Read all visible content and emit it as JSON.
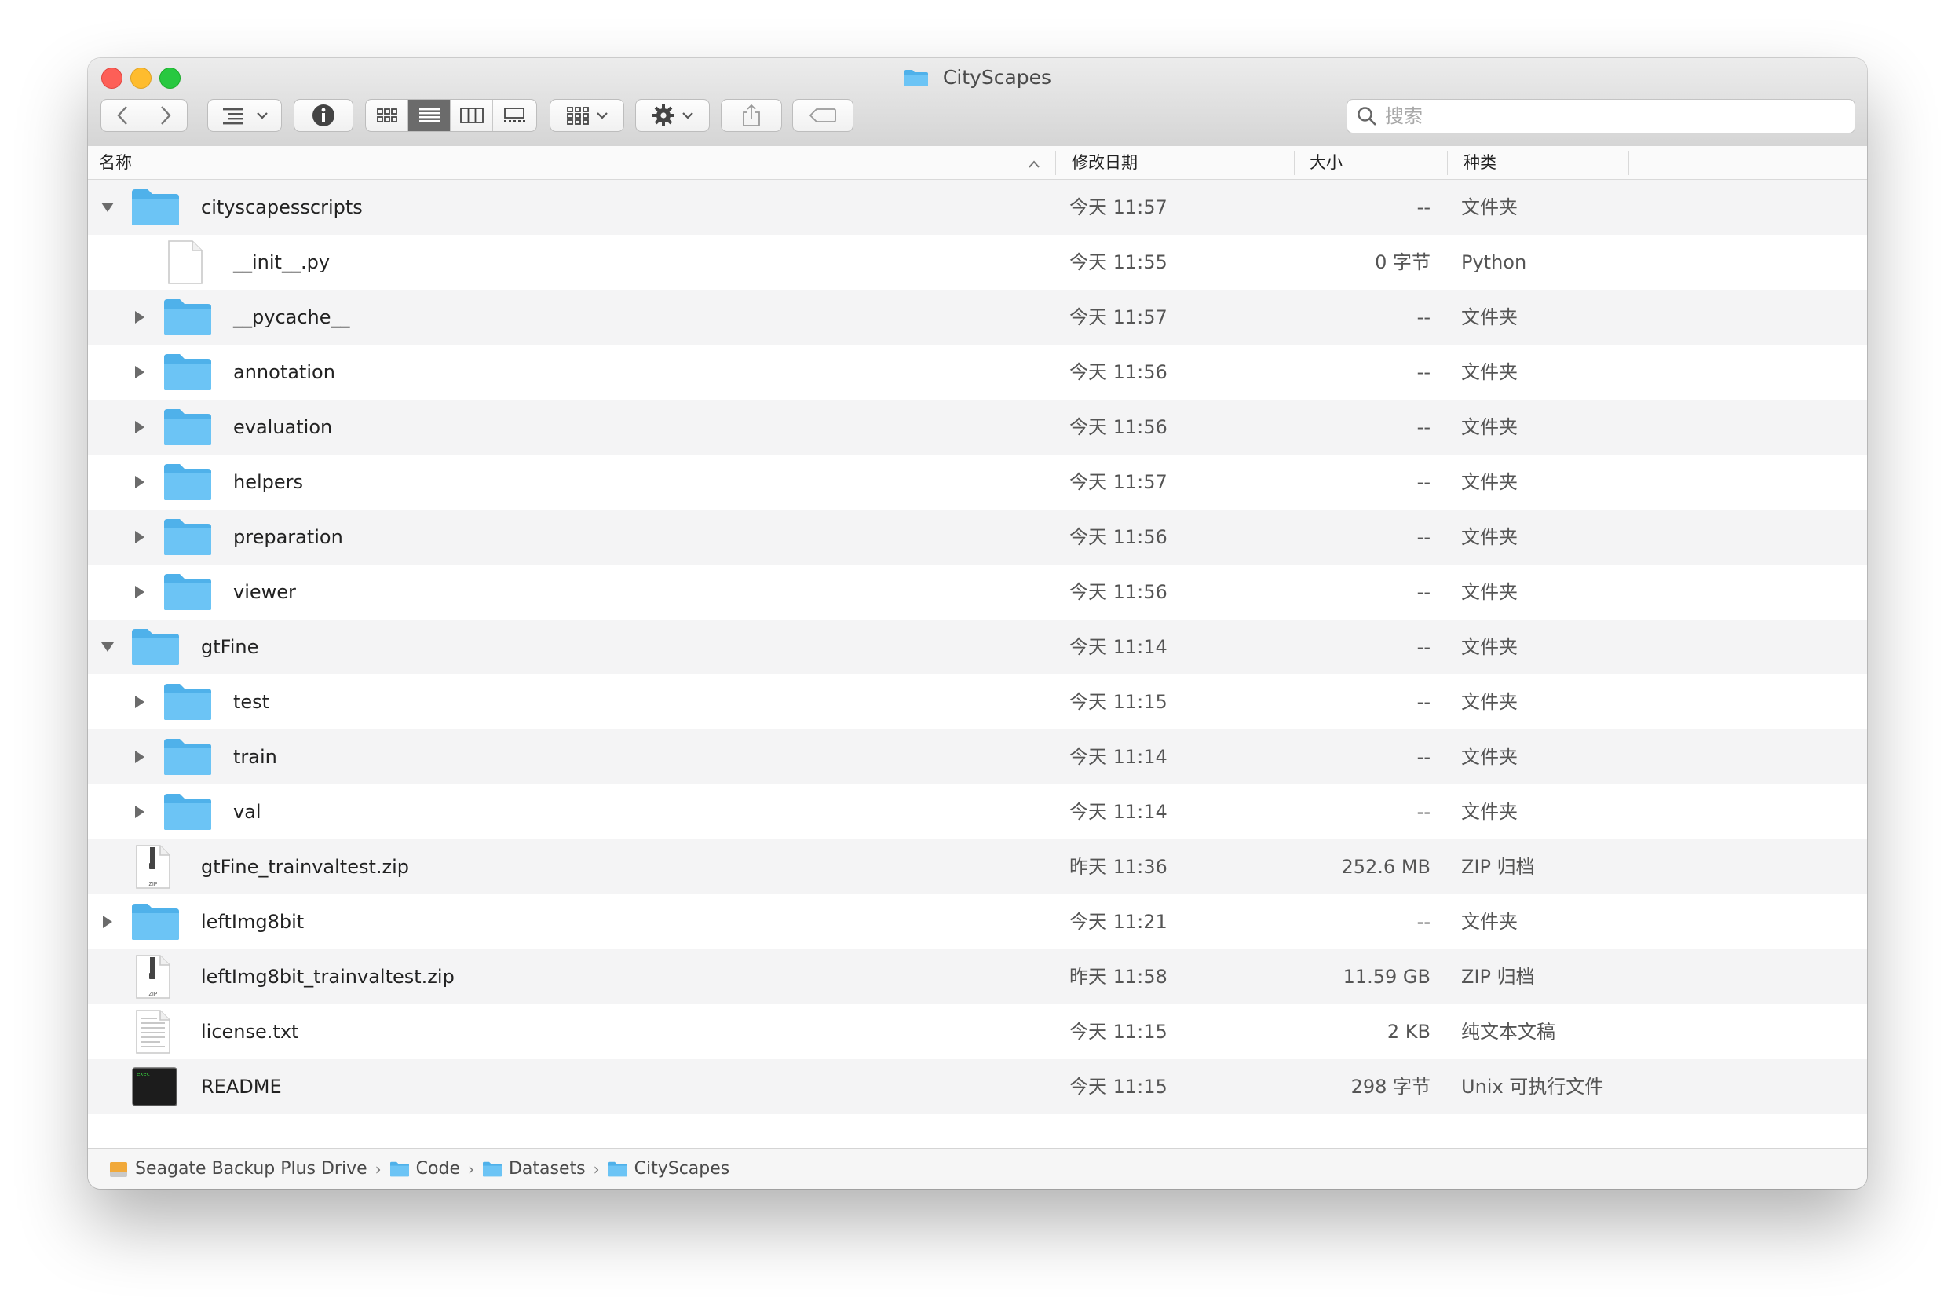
{
  "window": {
    "title": "CityScapes"
  },
  "toolbar": {
    "back_icon": "chevron-left-icon",
    "forward_icon": "chevron-right-icon",
    "search_placeholder": "搜索"
  },
  "columns": {
    "name": "名称",
    "date": "修改日期",
    "size": "大小",
    "kind": "种类"
  },
  "rows": [
    {
      "name": "cityscapesscripts",
      "date": "今天 11:57",
      "size": "--",
      "kind": "文件夹",
      "icon": "folder-icon",
      "disclosure": "expanded"
    },
    {
      "name": "__init__.py",
      "date": "今天 11:55",
      "size": "0 字节",
      "kind": "Python",
      "icon": "document-icon",
      "disclosure": "none"
    },
    {
      "name": "__pycache__",
      "date": "今天 11:57",
      "size": "--",
      "kind": "文件夹",
      "icon": "folder-icon",
      "disclosure": "collapsed"
    },
    {
      "name": "annotation",
      "date": "今天 11:56",
      "size": "--",
      "kind": "文件夹",
      "icon": "folder-icon",
      "disclosure": "collapsed"
    },
    {
      "name": "evaluation",
      "date": "今天 11:56",
      "size": "--",
      "kind": "文件夹",
      "icon": "folder-icon",
      "disclosure": "collapsed"
    },
    {
      "name": "helpers",
      "date": "今天 11:57",
      "size": "--",
      "kind": "文件夹",
      "icon": "folder-icon",
      "disclosure": "collapsed"
    },
    {
      "name": "preparation",
      "date": "今天 11:56",
      "size": "--",
      "kind": "文件夹",
      "icon": "folder-icon",
      "disclosure": "collapsed"
    },
    {
      "name": "viewer",
      "date": "今天 11:56",
      "size": "--",
      "kind": "文件夹",
      "icon": "folder-icon",
      "disclosure": "collapsed"
    },
    {
      "name": "gtFine",
      "date": "今天 11:14",
      "size": "--",
      "kind": "文件夹",
      "icon": "folder-icon",
      "disclosure": "expanded"
    },
    {
      "name": "test",
      "date": "今天 11:15",
      "size": "--",
      "kind": "文件夹",
      "icon": "folder-icon",
      "disclosure": "collapsed"
    },
    {
      "name": "train",
      "date": "今天 11:14",
      "size": "--",
      "kind": "文件夹",
      "icon": "folder-icon",
      "disclosure": "collapsed"
    },
    {
      "name": "val",
      "date": "今天 11:14",
      "size": "--",
      "kind": "文件夹",
      "icon": "folder-icon",
      "disclosure": "collapsed"
    },
    {
      "name": "gtFine_trainvaltest.zip",
      "date": "昨天 11:36",
      "size": "252.6 MB",
      "kind": "ZIP 归档",
      "icon": "zip-archive-icon",
      "disclosure": "none"
    },
    {
      "name": "leftImg8bit",
      "date": "今天 11:21",
      "size": "--",
      "kind": "文件夹",
      "icon": "folder-icon",
      "disclosure": "collapsed"
    },
    {
      "name": "leftImg8bit_trainvaltest.zip",
      "date": "昨天 11:58",
      "size": "11.59 GB",
      "kind": "ZIP 归档",
      "icon": "zip-archive-icon",
      "disclosure": "none"
    },
    {
      "name": "license.txt",
      "date": "今天 11:15",
      "size": "2 KB",
      "kind": "纯文本文稿",
      "icon": "text-document-icon",
      "disclosure": "none"
    },
    {
      "name": "README",
      "date": "今天 11:15",
      "size": "298 字节",
      "kind": "Unix 可执行文件",
      "icon": "unix-executable-icon",
      "disclosure": "none"
    }
  ],
  "pathbar": [
    {
      "label": "Seagate Backup Plus Drive",
      "icon": "external-drive-icon"
    },
    {
      "label": "Code",
      "icon": "folder-icon"
    },
    {
      "label": "Datasets",
      "icon": "folder-icon"
    },
    {
      "label": "CityScapes",
      "icon": "folder-icon"
    }
  ],
  "colors": {
    "folder": "#6cc4f5",
    "folder_dark": "#4fb1ea",
    "row_alt": "#f4f4f5"
  }
}
